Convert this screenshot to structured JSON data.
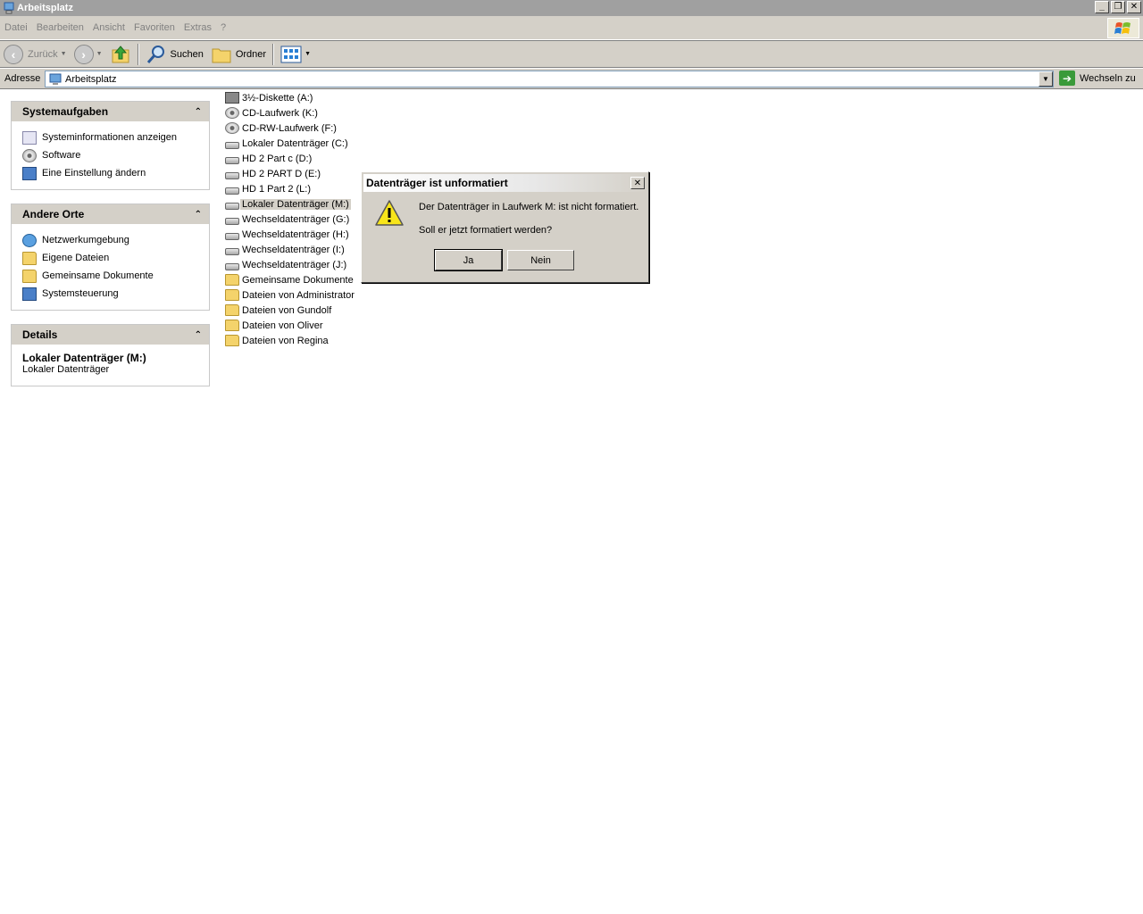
{
  "window": {
    "title": "Arbeitsplatz",
    "controls": {
      "minimize": "_",
      "restore": "❐",
      "close": "✕"
    }
  },
  "menu": [
    "Datei",
    "Bearbeiten",
    "Ansicht",
    "Favoriten",
    "Extras",
    "?"
  ],
  "toolbar": {
    "back_label": "Zurück",
    "search_label": "Suchen",
    "folders_label": "Ordner"
  },
  "address": {
    "label": "Adresse",
    "value": "Arbeitsplatz",
    "go_label": "Wechseln zu"
  },
  "tasks": {
    "system": {
      "title": "Systemaufgaben",
      "items": [
        "Systeminformationen anzeigen",
        "Software",
        "Eine Einstellung ändern"
      ]
    },
    "places": {
      "title": "Andere Orte",
      "items": [
        "Netzwerkumgebung",
        "Eigene Dateien",
        "Gemeinsame Dokumente",
        "Systemsteuerung"
      ]
    },
    "details": {
      "title": "Details",
      "name": "Lokaler Datenträger (M:)",
      "type": "Lokaler Datenträger"
    }
  },
  "files": [
    {
      "name": "3½-Diskette (A:)",
      "icon": "floppy-icon"
    },
    {
      "name": "CD-Laufwerk (K:)",
      "icon": "cd-drive-icon"
    },
    {
      "name": "CD-RW-Laufwerk (F:)",
      "icon": "cd-drive-icon"
    },
    {
      "name": "Lokaler Datenträger (C:)",
      "icon": "hard-drive-icon"
    },
    {
      "name": "HD 2 Part c (D:)",
      "icon": "hard-drive-icon"
    },
    {
      "name": "HD 2 PART D (E:)",
      "icon": "hard-drive-icon"
    },
    {
      "name": "HD 1 Part 2 (L:)",
      "icon": "hard-drive-icon"
    },
    {
      "name": "Lokaler Datenträger (M:)",
      "icon": "hard-drive-icon",
      "selected": true
    },
    {
      "name": "Wechseldatenträger (G:)",
      "icon": "removable-drive-icon"
    },
    {
      "name": "Wechseldatenträger (H:)",
      "icon": "removable-drive-icon"
    },
    {
      "name": "Wechseldatenträger (I:)",
      "icon": "removable-drive-icon"
    },
    {
      "name": "Wechseldatenträger (J:)",
      "icon": "removable-drive-icon"
    },
    {
      "name": "Gemeinsame Dokumente",
      "icon": "folder-icon"
    },
    {
      "name": "Dateien von Administrator",
      "icon": "folder-icon"
    },
    {
      "name": "Dateien von Gundolf",
      "icon": "folder-icon"
    },
    {
      "name": "Dateien von Oliver",
      "icon": "folder-icon"
    },
    {
      "name": "Dateien von Regina",
      "icon": "folder-icon"
    }
  ],
  "dialog": {
    "title": "Datenträger ist unformatiert",
    "message": "Der Datenträger in Laufwerk M: ist nicht formatiert.",
    "question": "Soll er jetzt formatiert werden?",
    "yes_label": "Ja",
    "no_label": "Nein",
    "close_glyph": "✕"
  }
}
